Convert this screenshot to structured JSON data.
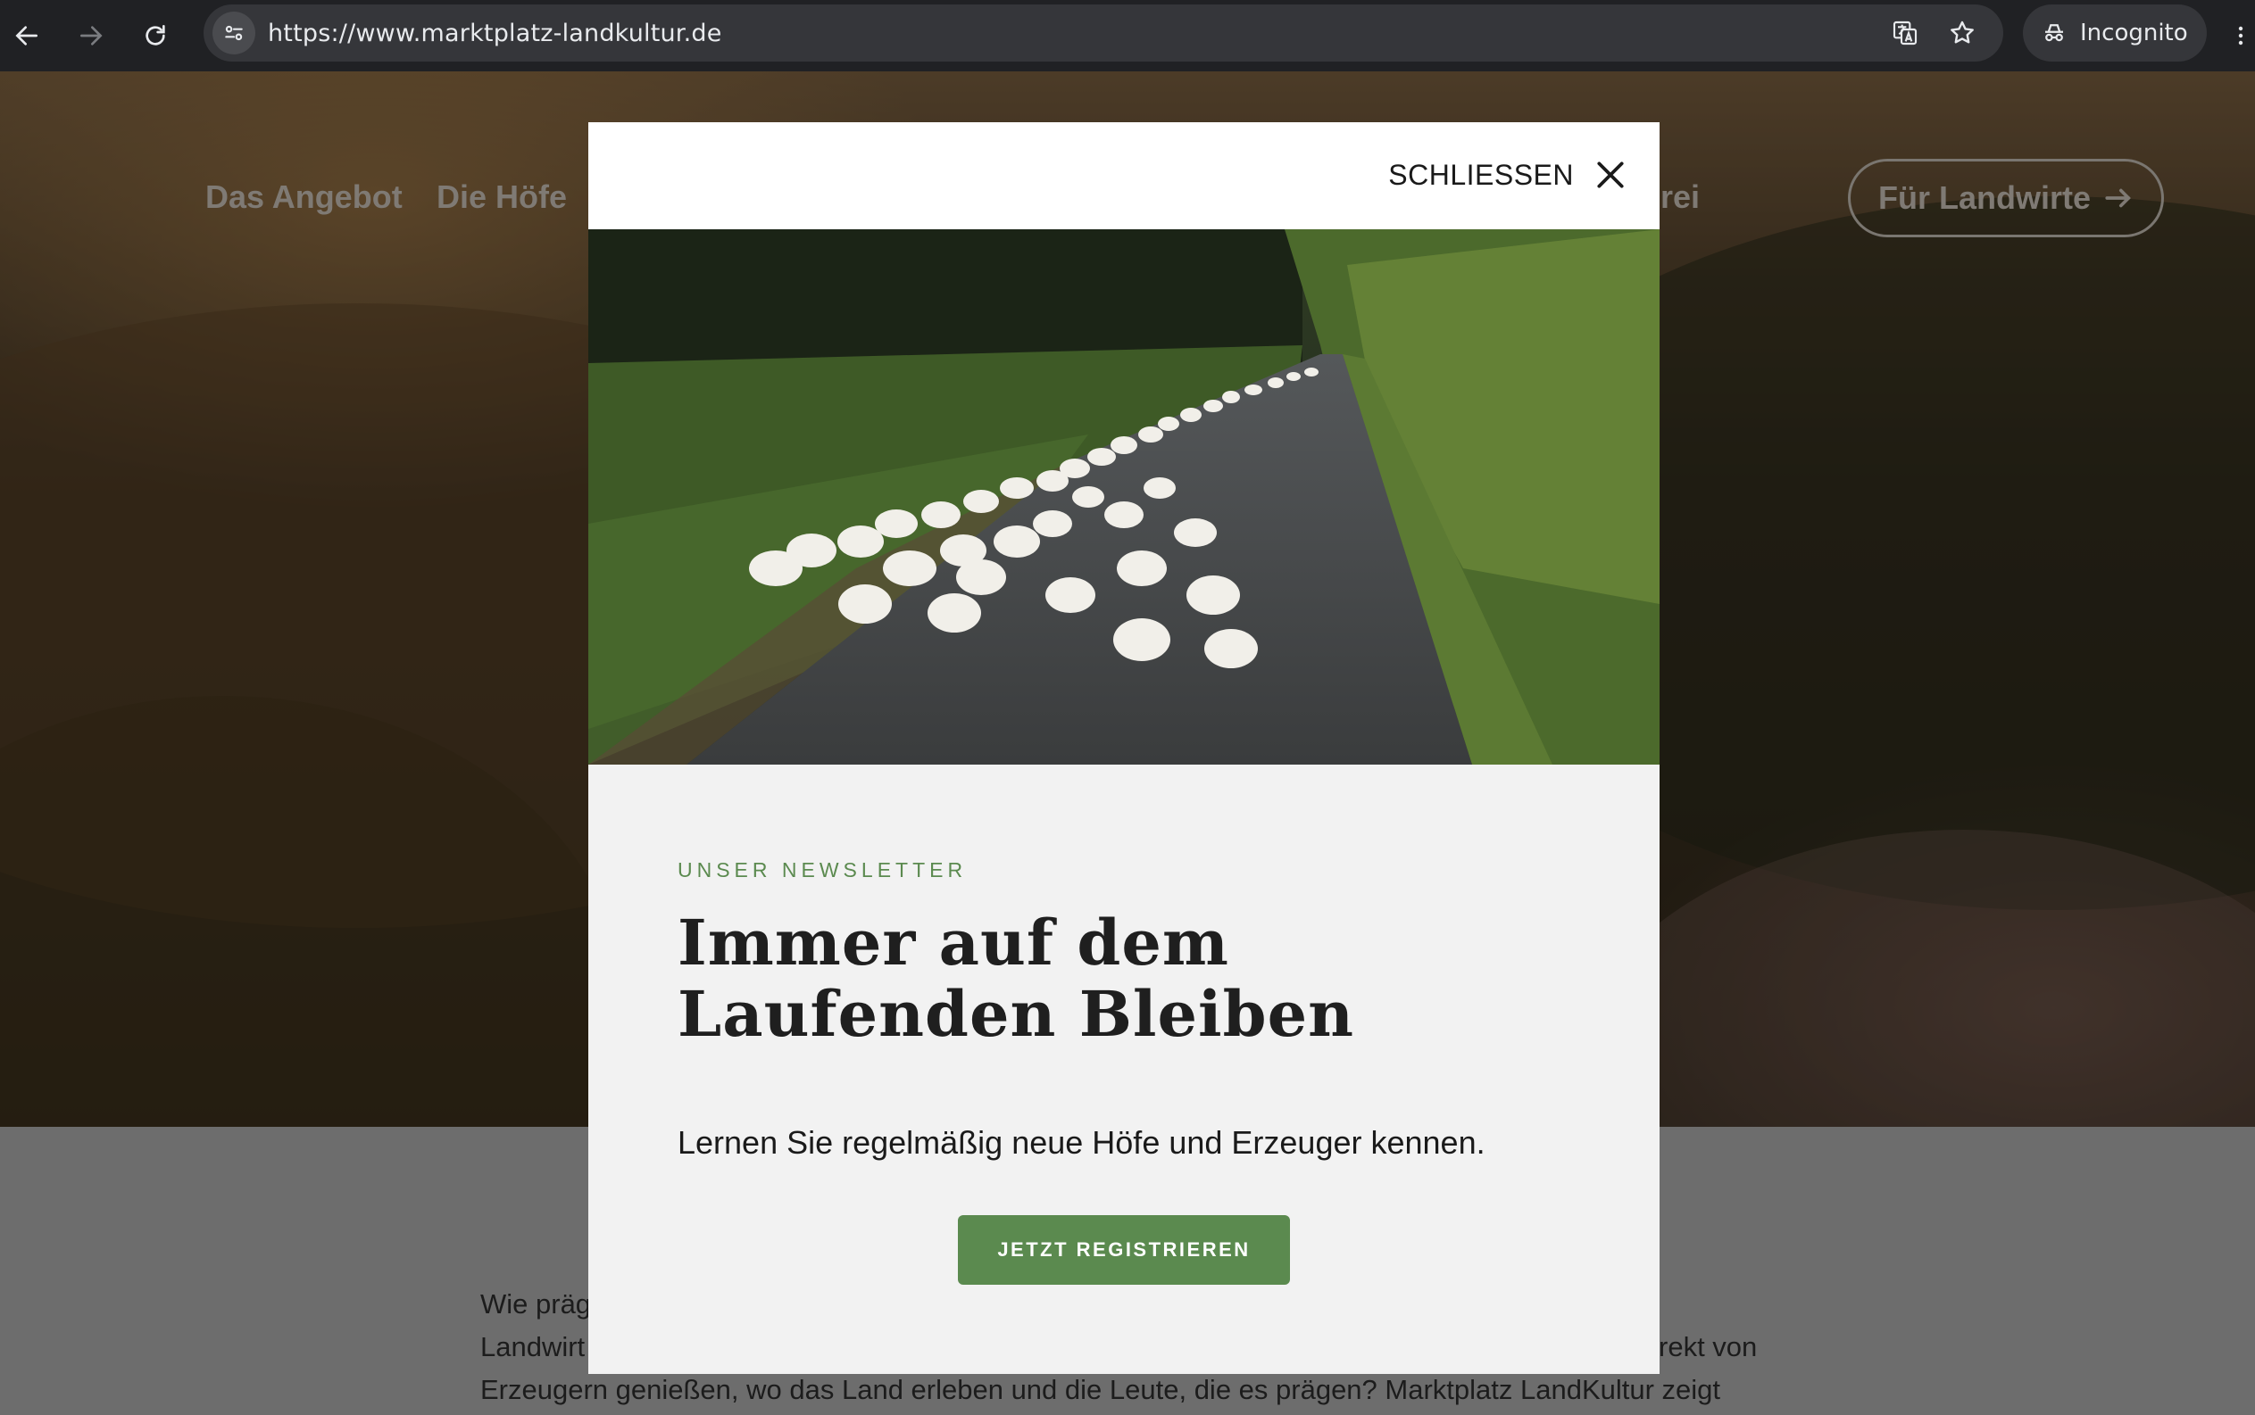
{
  "browser": {
    "url": "https://www.marktplatz-landkultur.de",
    "profile_label": "Incognito",
    "icons": [
      "back-arrow-icon",
      "forward-arrow-icon",
      "reload-icon",
      "site-info-icon",
      "translate-icon",
      "bookmark-star-icon",
      "incognito-icon",
      "menu-dots-icon"
    ]
  },
  "site_nav": {
    "items": [
      "Das Angebot",
      "Die Höfe"
    ],
    "partial_item": "rei",
    "cta_label": "Für Landwirte"
  },
  "background_text": {
    "line1": "Wie präg",
    "line2_start": "Landwirt",
    "line2_end": "rekt von",
    "line3": "Erzeugern genießen, wo das Land erleben und die Leute, die es prägen? Marktplatz LandKultur zeigt"
  },
  "modal": {
    "close_label": "SCHLIESSEN",
    "image_alt": "Gänseherde auf einem Landweg",
    "eyebrow": "UNSER NEWSLETTER",
    "headline_line1": "Immer auf dem",
    "headline_line2": "Laufenden Bleiben",
    "lead": "Lernen Sie regelmäßig neue Höfe und Erzeuger kennen.",
    "button_label": "JETZT REGISTRIEREN"
  },
  "colors": {
    "accent_green": "#5b8a4f",
    "chrome_bg": "#202124",
    "modal_bg": "#f2f2f2"
  }
}
